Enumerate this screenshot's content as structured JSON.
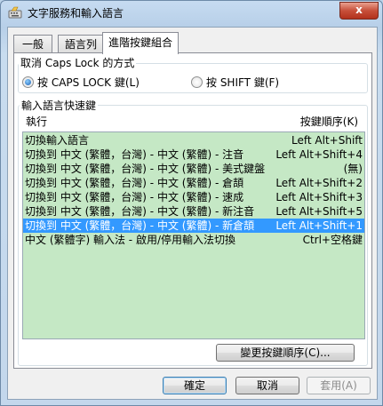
{
  "window": {
    "title": "文字服務和輸入語言",
    "close_label": "x"
  },
  "tabs": [
    {
      "label": "一般"
    },
    {
      "label": "語言列"
    },
    {
      "label": "進階按鍵組合"
    }
  ],
  "caps_lock": {
    "group_title": "取消 Caps Lock 的方式",
    "option_caps": "按 CAPS LOCK 鍵(L)",
    "option_shift": "按 SHIFT 鍵(F)",
    "selected": "caps"
  },
  "hotkeys": {
    "group_title": "輸入語言快速鍵",
    "col_action": "執行",
    "col_sequence": "按鍵順序(K)",
    "rows": [
      {
        "action": "切換輸入語言",
        "keys": "Left Alt+Shift",
        "selected": false
      },
      {
        "action": "切換到 中文 (繁體，台灣) - 中文 (繁體) - 注音",
        "keys": "Left Alt+Shift+4",
        "selected": false
      },
      {
        "action": "切換到 中文 (繁體，台灣) - 中文 (繁體) - 美式鍵盤",
        "keys": "(無)",
        "selected": false
      },
      {
        "action": "切換到 中文 (繁體，台灣) - 中文 (繁體) - 倉頡",
        "keys": "Left Alt+Shift+2",
        "selected": false
      },
      {
        "action": "切換到 中文 (繁體，台灣) - 中文 (繁體) - 速成",
        "keys": "Left Alt+Shift+3",
        "selected": false
      },
      {
        "action": "切換到 中文 (繁體，台灣) - 中文 (繁體) - 新注音",
        "keys": "Left Alt+Shift+5",
        "selected": false
      },
      {
        "action": "切換到 中文 (繁體，台灣) - 中文 (繁體) - 新倉頡",
        "keys": "Left Alt+Shift+1",
        "selected": true
      },
      {
        "action": "中文 (繁體字) 輸入法 - 啟用/停用輸入法切換",
        "keys": "Ctrl+空格鍵",
        "selected": false
      }
    ],
    "change_button": "變更按鍵順序(C)..."
  },
  "buttons": {
    "ok": "確定",
    "cancel": "取消",
    "apply": "套用(A)"
  },
  "colors": {
    "list_background": "#c5e8c5",
    "selection": "#3399ff"
  }
}
